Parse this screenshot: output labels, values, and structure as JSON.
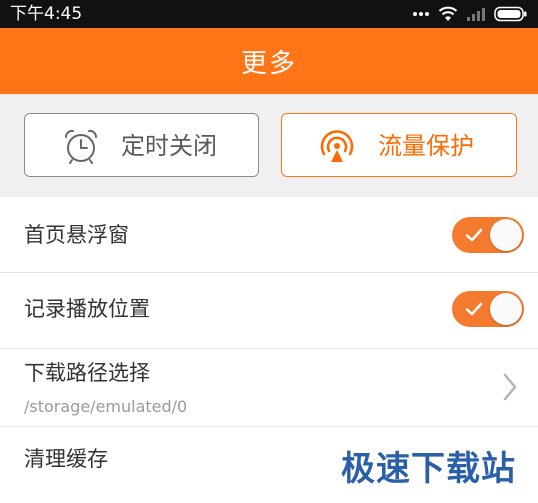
{
  "status_bar": {
    "time": "下午4:45",
    "icons": [
      "more-dots-icon",
      "wifi-icon",
      "signal-icon",
      "battery-icon"
    ]
  },
  "header": {
    "title": "更多"
  },
  "quick_actions": [
    {
      "label": "定时关闭",
      "icon": "alarm-clock-icon"
    },
    {
      "label": "流量保护",
      "icon": "traffic-protect-icon"
    }
  ],
  "settings": [
    {
      "title": "首页悬浮窗",
      "control": "toggle",
      "on": true
    },
    {
      "title": "记录播放位置",
      "control": "toggle",
      "on": true
    },
    {
      "title": "下载路径选择",
      "subtitle": "/storage/emulated/0",
      "control": "chevron"
    },
    {
      "title": "清理缓存"
    }
  ],
  "watermark": "极速下载站",
  "colors": {
    "accent": "#ff7518",
    "toggle_on": "#f47a2e",
    "status_bar": "#111111",
    "watermark": "#2b5fa8"
  }
}
